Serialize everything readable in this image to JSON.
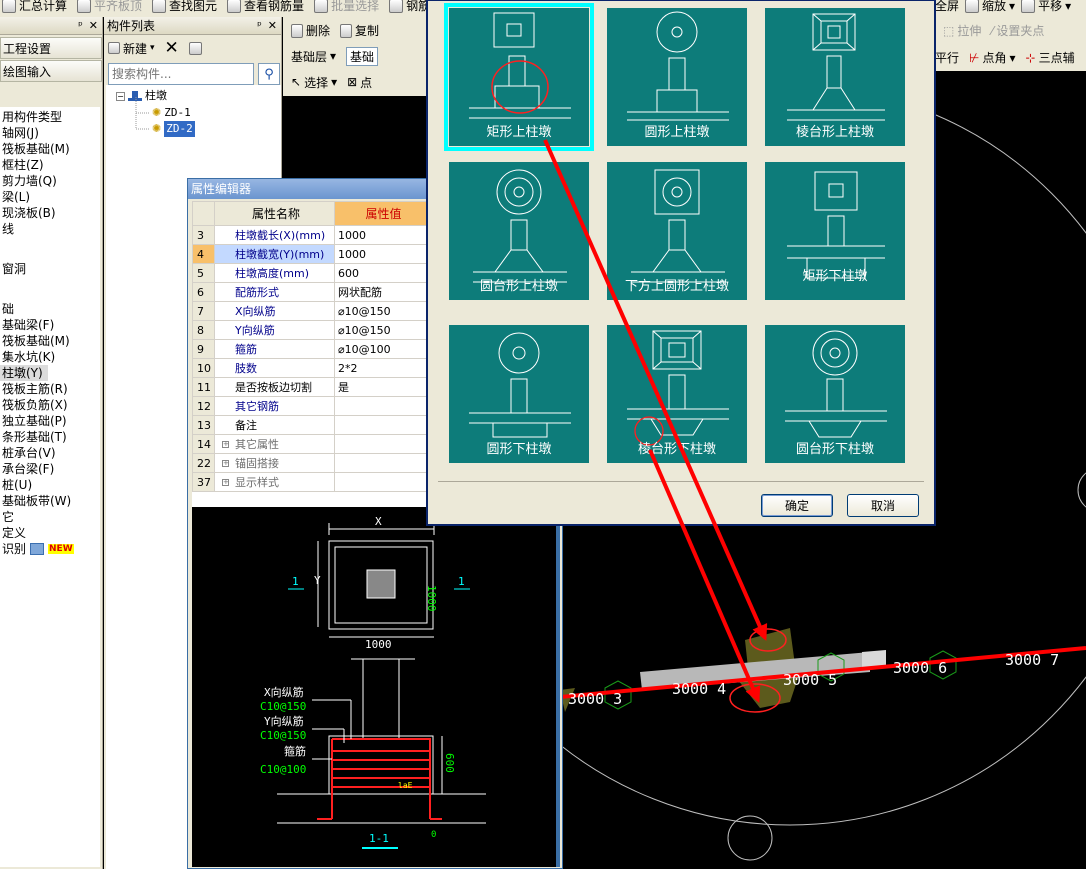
{
  "main_toolbar": {
    "items": [
      "汇总计算",
      "平齐板顶",
      "查找图元",
      "查看钢筋量",
      "批量选择",
      "钢筋"
    ],
    "right_items": [
      "全屏",
      "缩放",
      "平移"
    ]
  },
  "toolbar2": {
    "delete": "删除",
    "copy": "复制"
  },
  "toolbar3": {
    "layer": "基础层",
    "category": "基础"
  },
  "toolbar4": {
    "select": "选择",
    "point": "点"
  },
  "right_toolbar2": {
    "stretch": "拉伸",
    "set_grip": "设置夹点"
  },
  "right_toolbar3": {
    "parallel": "平行",
    "point_angle": "点角",
    "three_point": "三点辅"
  },
  "left_panel": {
    "nav_buttons": [
      "工程设置",
      "绘图输入"
    ],
    "tree": [
      "用构件类型",
      "轴网(J)",
      "筏板基础(M)",
      "框柱(Z)",
      "剪力墙(Q)",
      "梁(L)",
      "现浇板(B)",
      "线",
      "",
      "窗洞",
      "",
      "础",
      "基础梁(F)",
      "筏板基础(M)",
      "集水坑(K)",
      "柱墩(Y)",
      "筏板主筋(R)",
      "筏板负筋(X)",
      "独立基础(P)",
      "条形基础(T)",
      "桩承台(V)",
      "承台梁(F)",
      "桩(U)",
      "基础板带(W)",
      "它",
      "定义",
      "识别"
    ],
    "new_badge": "NEW"
  },
  "component_panel": {
    "title": "构件列表",
    "new_button": "新建",
    "search_placeholder": "搜索构件...",
    "root": "柱墩",
    "children": [
      "ZD-1",
      "ZD-2"
    ]
  },
  "property_editor": {
    "title": "属性编辑器",
    "col_name": "属性名称",
    "col_value": "属性值",
    "rows": [
      {
        "num": "3",
        "name": "柱墩截长(X)(mm)",
        "value": "1000"
      },
      {
        "num": "4",
        "name": "柱墩截宽(Y)(mm)",
        "value": "1000"
      },
      {
        "num": "5",
        "name": "柱墩高度(mm)",
        "value": "600"
      },
      {
        "num": "6",
        "name": "配筋形式",
        "value": "网状配筋"
      },
      {
        "num": "7",
        "name": "X向纵筋",
        "value": "⌀10@150"
      },
      {
        "num": "8",
        "name": "Y向纵筋",
        "value": "⌀10@150"
      },
      {
        "num": "9",
        "name": "箍筋",
        "value": "⌀10@100"
      },
      {
        "num": "10",
        "name": "肢数",
        "value": "2*2"
      },
      {
        "num": "11",
        "name": "是否按板边切割",
        "value": "是"
      },
      {
        "num": "12",
        "name": "其它钢筋",
        "value": ""
      },
      {
        "num": "13",
        "name": "备注",
        "value": ""
      },
      {
        "num": "14",
        "name": "其它属性",
        "value": ""
      },
      {
        "num": "22",
        "name": "锚固搭接",
        "value": ""
      },
      {
        "num": "37",
        "name": "显示样式",
        "value": ""
      }
    ]
  },
  "preview": {
    "dim_x": "X",
    "dim_y": "Y",
    "dim_1000_bottom": "1000",
    "dim_1000_side": "1000",
    "marker_left": "1",
    "marker_right": "1",
    "x_label": "X向纵筋",
    "x_value": "C10@150",
    "y_label": "Y向纵筋",
    "y_value": "C10@150",
    "stirrup_label": "箍筋",
    "stirrup_value": "C10@100",
    "height_dim": "600",
    "lae": "laE",
    "zero": "0",
    "section": "1-1"
  },
  "dialog": {
    "types": [
      "矩形上柱墩",
      "圆形上柱墩",
      "棱台形上柱墩",
      "圆台形上柱墩",
      "下方上圆形上柱墩",
      "矩形下柱墩",
      "圆形下柱墩",
      "棱台形下柱墩",
      "圆台形下柱墩"
    ],
    "ok": "确定",
    "cancel": "取消"
  },
  "canvas": {
    "labels": [
      "3000 3",
      "3000 4",
      "3000 5",
      "3000 6",
      "3000 7"
    ],
    "colors": {
      "red": "#ff0000",
      "gray_beam": "#b8b8b8",
      "olive": "#5c5a1c",
      "grid": "#bfbfbf"
    }
  }
}
